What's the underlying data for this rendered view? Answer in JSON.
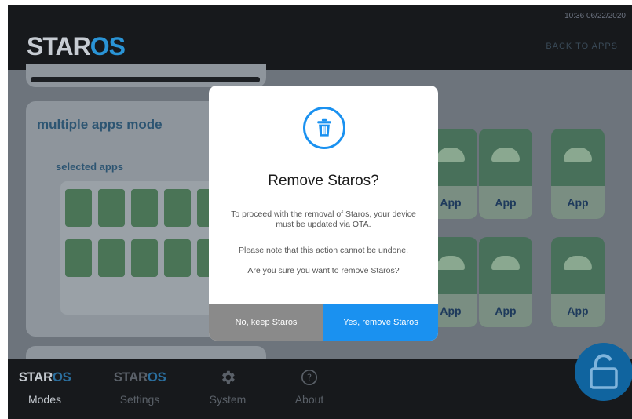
{
  "status_bar": {
    "time": "10:36",
    "date": "06/22/2020"
  },
  "header": {
    "logo_star": "STAR",
    "logo_os": "OS",
    "back_label": "BACK TO APPS"
  },
  "cards": {
    "multi_title": "multiple apps mode",
    "selected_title": "selected apps"
  },
  "apps": [
    {
      "label": "App"
    },
    {
      "label": "App"
    },
    {
      "label": "App"
    },
    {
      "label": "App"
    },
    {
      "label": "App"
    },
    {
      "label": "App"
    }
  ],
  "nav": {
    "modes": {
      "logo_star": "STAR",
      "logo_os": "OS",
      "label": "Modes"
    },
    "settings": {
      "logo_star": "STAR",
      "logo_os": "OS",
      "label": "Settings"
    },
    "system": {
      "label": "System",
      "icon": "gear-icon"
    },
    "about": {
      "label": "About",
      "icon": "help-icon"
    }
  },
  "modal": {
    "icon": "trash-icon",
    "title": "Remove Staros?",
    "line1": "To proceed with the removal of Staros, your device must be updated via OTA.",
    "line2": "Please note that this action cannot be undone.",
    "line3": "Are you sure you want to remove Staros?",
    "cancel_label": "No, keep Staros",
    "confirm_label": "Yes, remove Staros"
  },
  "colors": {
    "accent": "#1a91f0",
    "cancel": "#8a8a8a",
    "topbar": "#17191c"
  }
}
